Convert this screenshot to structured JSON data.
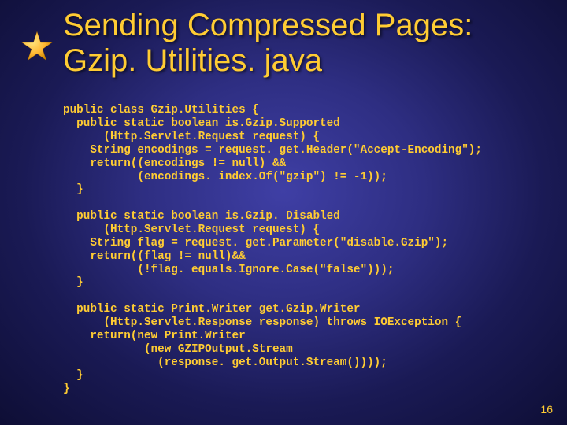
{
  "title": "Sending Compressed Pages:\nGzip. Utilities. java",
  "code": "public class Gzip.Utilities {\n  public static boolean is.Gzip.Supported\n      (Http.Servlet.Request request) {\n    String encodings = request. get.Header(\"Accept-Encoding\");\n    return((encodings != null) &&\n           (encodings. index.Of(\"gzip\") != -1));\n  }\n\n  public static boolean is.Gzip. Disabled\n      (Http.Servlet.Request request) {\n    String flag = request. get.Parameter(\"disable.Gzip\");\n    return((flag != null)&&\n           (!flag. equals.Ignore.Case(\"false\")));\n  }\n\n  public static Print.Writer get.Gzip.Writer\n      (Http.Servlet.Response response) throws IOException {\n    return(new Print.Writer\n            (new GZIPOutput.Stream\n              (response. get.Output.Stream())));\n  }\n}",
  "page_number": "16",
  "icons": {
    "star": "star-icon"
  },
  "colors": {
    "text": "#ffcc33",
    "bg_inner": "#3f3fa5",
    "bg_outer": "#0e0e35"
  }
}
